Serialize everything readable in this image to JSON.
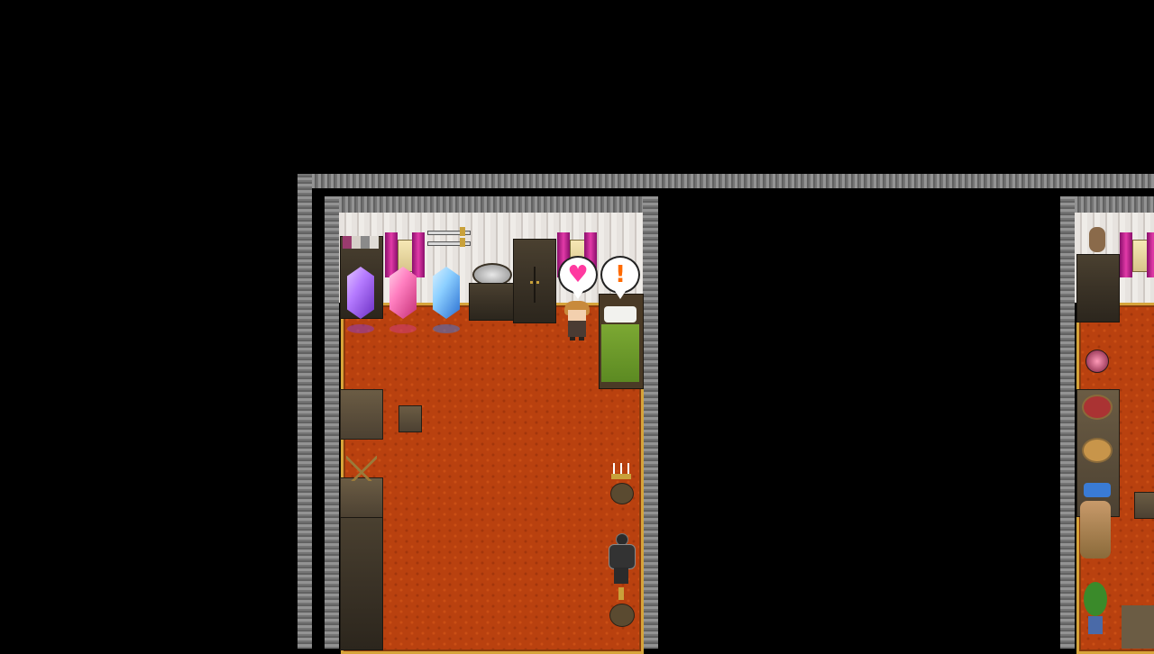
{
  "scene": {
    "type": "rpg-map",
    "map_view": "interior-bedroom"
  },
  "speech_bubbles": [
    {
      "name": "heart",
      "glyph": "♥",
      "color": "#ff3aa0"
    },
    {
      "name": "exclamation",
      "glyph": "!",
      "color": "#ff6a00"
    }
  ],
  "colors": {
    "carpet": "#b9410f",
    "carpet_trim": "#d6a43a",
    "curtain": "#d6309e",
    "bed_blanket": "#6c9a2a"
  },
  "crystals": [
    {
      "name": "purple-crystal",
      "color_a": "#b57bff",
      "color_b": "#6b2fc2"
    },
    {
      "name": "pink-crystal",
      "color_a": "#ff7fc0",
      "color_b": "#c42f76"
    },
    {
      "name": "blue-crystal",
      "color_a": "#8ccfff",
      "color_b": "#2a6fd1"
    }
  ]
}
